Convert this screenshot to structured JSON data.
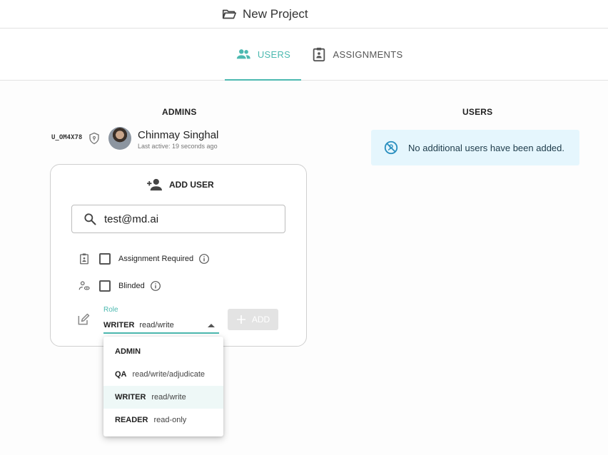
{
  "header": {
    "project_title": "New Project",
    "folder_icon": "folder-open-icon"
  },
  "tabs": [
    {
      "label": "USERS",
      "icon": "people-icon",
      "active": true
    },
    {
      "label": "ASSIGNMENTS",
      "icon": "clipboard-icon",
      "active": false
    }
  ],
  "admins": {
    "title": "ADMINS",
    "items": [
      {
        "id": "U_OM4X78",
        "name": "Chinmay Singhal",
        "last_active": "Last active: 19 seconds ago"
      }
    ]
  },
  "add_user": {
    "title": "ADD USER",
    "search_value": "test@md.ai",
    "options": [
      {
        "label": "Assignment Required",
        "checked": false
      },
      {
        "label": "Blinded",
        "checked": false
      }
    ],
    "role_label": "Role",
    "role_selected": {
      "name": "WRITER",
      "desc": "read/write"
    },
    "add_button": "ADD"
  },
  "role_dropdown": [
    {
      "name": "ADMIN",
      "desc": ""
    },
    {
      "name": "QA",
      "desc": "read/write/adjudicate"
    },
    {
      "name": "WRITER",
      "desc": "read/write"
    },
    {
      "name": "READER",
      "desc": "read-only"
    }
  ],
  "users": {
    "title": "USERS",
    "empty_message": "No additional users have been added."
  },
  "colors": {
    "accent": "#4cb9b0",
    "info_bg": "#e5f6fd",
    "border": "#cfcfcf"
  }
}
